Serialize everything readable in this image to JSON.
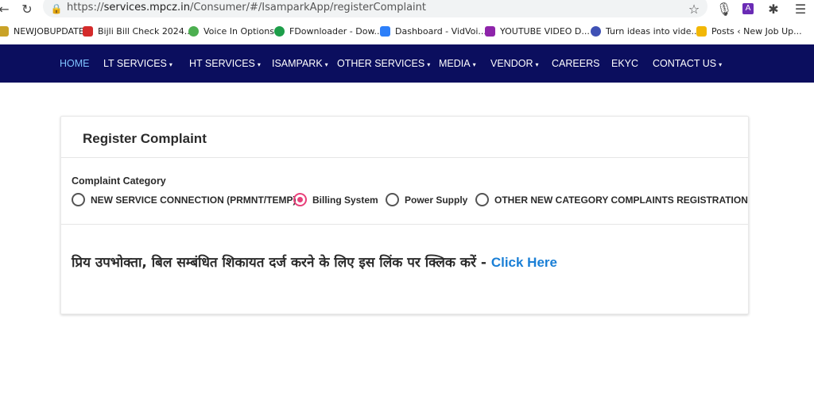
{
  "browser": {
    "url_prefix": "https://",
    "url_host": "services.mpcz.in",
    "url_path": "/Consumer/#/IsamparkApp/registerComplaint",
    "bookmarks": [
      {
        "label": "NEWJOBUPDATE",
        "color": "#c9a227"
      },
      {
        "label": "Bijli Bill Check 2024...",
        "color": "#d42b2b"
      },
      {
        "label": "Voice In Options",
        "color": "#4caf50"
      },
      {
        "label": "FDownloader - Dow...",
        "color": "#1e9e4a"
      },
      {
        "label": "Dashboard - VidVoi...",
        "color": "#2d7ff9"
      },
      {
        "label": "YOUTUBE VIDEO D...",
        "color": "#8e24aa"
      },
      {
        "label": "Turn ideas into vide...",
        "color": "#3f51b5"
      },
      {
        "label": "Posts ‹ New Job Up...",
        "color": "#f2b705"
      }
    ]
  },
  "navbar": {
    "items": [
      {
        "label": "HOME",
        "caret": false,
        "active": true
      },
      {
        "label": "LT SERVICES",
        "caret": true
      },
      {
        "label": "HT SERVICES",
        "caret": true
      },
      {
        "label": "ISAMPARK",
        "caret": true
      },
      {
        "label": "OTHER SERVICES",
        "caret": true
      },
      {
        "label": "MEDIA",
        "caret": true
      },
      {
        "label": "VENDOR",
        "caret": true
      },
      {
        "label": "CAREERS",
        "caret": false
      },
      {
        "label": "EKYC",
        "caret": false
      },
      {
        "label": "CONTACT US",
        "caret": true
      }
    ]
  },
  "card": {
    "title": "Register Complaint",
    "category_label": "Complaint Category",
    "options": [
      {
        "label": "NEW SERVICE CONNECTION (PRMNT/TEMP)",
        "checked": false
      },
      {
        "label": "Billing System",
        "checked": true
      },
      {
        "label": "Power Supply",
        "checked": false
      },
      {
        "label": "OTHER NEW CATEGORY COMPLAINTS REGISTRATION",
        "checked": false
      }
    ],
    "message_hindi": "प्रिय उपभोक्ता, बिल सम्बंधित शिकायत दर्ज करने के लिए इस लिंक पर क्लिक करें - ",
    "link_text": "Click Here"
  },
  "colors": {
    "navbar_bg": "#0b0e5e",
    "nav_active": "#7fc2ff",
    "radio_checked": "#e8407a",
    "link": "#1a7fd6"
  }
}
